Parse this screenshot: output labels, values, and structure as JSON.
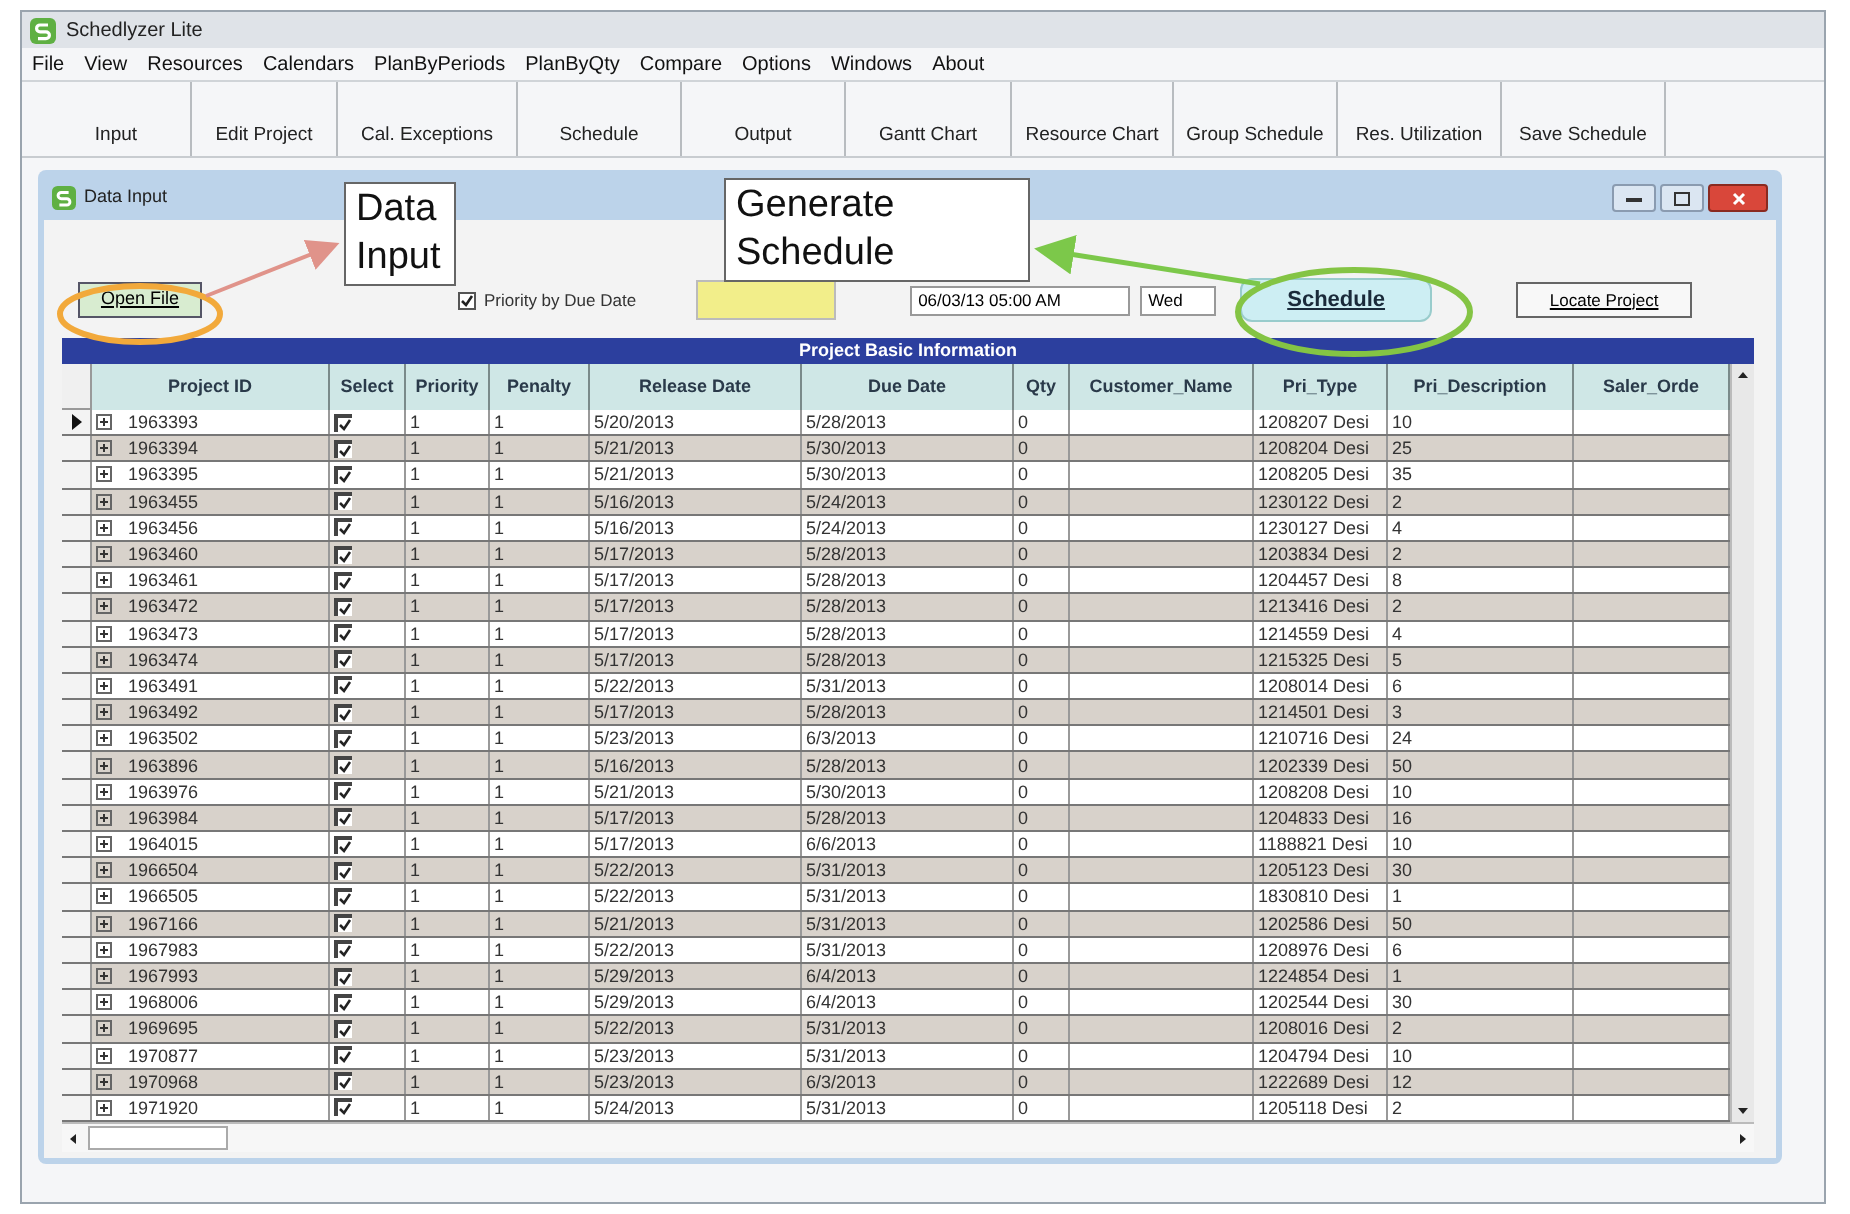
{
  "window": {
    "title": "Schedlyzer Lite"
  },
  "menu": [
    "File",
    "View",
    "Resources",
    "Calendars",
    "PlanByPeriods",
    "PlanByQty",
    "Compare",
    "Options",
    "Windows",
    "About"
  ],
  "toolbar": [
    "Input",
    "Edit Project",
    "Cal. Exceptions",
    "Schedule",
    "Output",
    "Gantt Chart",
    "Resource Chart",
    "Group Schedule",
    "Res. Utilization",
    "Save Schedule"
  ],
  "child_window": {
    "title": "Data Input",
    "controls": {
      "open_file": "Open File",
      "priority_checkbox": {
        "label": "Priority by Due Date",
        "checked": true
      },
      "date_field": "06/03/13 05:00 AM",
      "day_field": "Wed",
      "schedule": "Schedule",
      "locate_project": "Locate Project"
    }
  },
  "annotations": [
    {
      "text": "Data Input"
    },
    {
      "text": "Generate Schedule"
    }
  ],
  "table": {
    "caption": "Project Basic Information",
    "columns": [
      "Project ID",
      "Select",
      "Priority",
      "Penalty",
      "Release Date",
      "Due Date",
      "Qty",
      "Customer_Name",
      "Pri_Type",
      "Pri_Description",
      "Saler_Orde"
    ],
    "rows": [
      {
        "current": true,
        "project_id": "1963393",
        "select": true,
        "priority": "1",
        "penalty": "1",
        "release_date": "5/20/2013",
        "due_date": "5/28/2013",
        "qty": "0",
        "pri_type": "1208207 Desi",
        "pri_description": "10"
      },
      {
        "current": false,
        "project_id": "1963394",
        "select": true,
        "priority": "1",
        "penalty": "1",
        "release_date": "5/21/2013",
        "due_date": "5/30/2013",
        "qty": "0",
        "pri_type": "1208204 Desi",
        "pri_description": "25"
      },
      {
        "current": false,
        "project_id": "1963395",
        "select": true,
        "priority": "1",
        "penalty": "1",
        "release_date": "5/21/2013",
        "due_date": "5/30/2013",
        "qty": "0",
        "pri_type": "1208205 Desi",
        "pri_description": "35"
      },
      {
        "current": false,
        "project_id": "1963455",
        "select": true,
        "priority": "1",
        "penalty": "1",
        "release_date": "5/16/2013",
        "due_date": "5/24/2013",
        "qty": "0",
        "pri_type": "1230122 Desi",
        "pri_description": "2"
      },
      {
        "current": false,
        "project_id": "1963456",
        "select": true,
        "priority": "1",
        "penalty": "1",
        "release_date": "5/16/2013",
        "due_date": "5/24/2013",
        "qty": "0",
        "pri_type": "1230127 Desi",
        "pri_description": "4"
      },
      {
        "current": false,
        "project_id": "1963460",
        "select": true,
        "priority": "1",
        "penalty": "1",
        "release_date": "5/17/2013",
        "due_date": "5/28/2013",
        "qty": "0",
        "pri_type": "1203834 Desi",
        "pri_description": "2"
      },
      {
        "current": false,
        "project_id": "1963461",
        "select": true,
        "priority": "1",
        "penalty": "1",
        "release_date": "5/17/2013",
        "due_date": "5/28/2013",
        "qty": "0",
        "pri_type": "1204457 Desi",
        "pri_description": "8"
      },
      {
        "current": false,
        "project_id": "1963472",
        "select": true,
        "priority": "1",
        "penalty": "1",
        "release_date": "5/17/2013",
        "due_date": "5/28/2013",
        "qty": "0",
        "pri_type": "1213416 Desi",
        "pri_description": "2"
      },
      {
        "current": false,
        "project_id": "1963473",
        "select": true,
        "priority": "1",
        "penalty": "1",
        "release_date": "5/17/2013",
        "due_date": "5/28/2013",
        "qty": "0",
        "pri_type": "1214559 Desi",
        "pri_description": "4"
      },
      {
        "current": false,
        "project_id": "1963474",
        "select": true,
        "priority": "1",
        "penalty": "1",
        "release_date": "5/17/2013",
        "due_date": "5/28/2013",
        "qty": "0",
        "pri_type": "1215325 Desi",
        "pri_description": "5"
      },
      {
        "current": false,
        "project_id": "1963491",
        "select": true,
        "priority": "1",
        "penalty": "1",
        "release_date": "5/22/2013",
        "due_date": "5/31/2013",
        "qty": "0",
        "pri_type": "1208014 Desi",
        "pri_description": "6"
      },
      {
        "current": false,
        "project_id": "1963492",
        "select": true,
        "priority": "1",
        "penalty": "1",
        "release_date": "5/17/2013",
        "due_date": "5/28/2013",
        "qty": "0",
        "pri_type": "1214501 Desi",
        "pri_description": "3"
      },
      {
        "current": false,
        "project_id": "1963502",
        "select": true,
        "priority": "1",
        "penalty": "1",
        "release_date": "5/23/2013",
        "due_date": "6/3/2013",
        "qty": "0",
        "pri_type": "1210716 Desi",
        "pri_description": "24"
      },
      {
        "current": false,
        "project_id": "1963896",
        "select": true,
        "priority": "1",
        "penalty": "1",
        "release_date": "5/16/2013",
        "due_date": "5/28/2013",
        "qty": "0",
        "pri_type": "1202339 Desi",
        "pri_description": "50"
      },
      {
        "current": false,
        "project_id": "1963976",
        "select": true,
        "priority": "1",
        "penalty": "1",
        "release_date": "5/21/2013",
        "due_date": "5/30/2013",
        "qty": "0",
        "pri_type": "1208208 Desi",
        "pri_description": "10"
      },
      {
        "current": false,
        "project_id": "1963984",
        "select": true,
        "priority": "1",
        "penalty": "1",
        "release_date": "5/17/2013",
        "due_date": "5/28/2013",
        "qty": "0",
        "pri_type": "1204833 Desi",
        "pri_description": "16"
      },
      {
        "current": false,
        "project_id": "1964015",
        "select": true,
        "priority": "1",
        "penalty": "1",
        "release_date": "5/17/2013",
        "due_date": "6/6/2013",
        "qty": "0",
        "pri_type": "1188821 Desi",
        "pri_description": "10"
      },
      {
        "current": false,
        "project_id": "1966504",
        "select": true,
        "priority": "1",
        "penalty": "1",
        "release_date": "5/22/2013",
        "due_date": "5/31/2013",
        "qty": "0",
        "pri_type": "1205123 Desi",
        "pri_description": "30"
      },
      {
        "current": false,
        "project_id": "1966505",
        "select": true,
        "priority": "1",
        "penalty": "1",
        "release_date": "5/22/2013",
        "due_date": "5/31/2013",
        "qty": "0",
        "pri_type": "1830810 Desi",
        "pri_description": "1"
      },
      {
        "current": false,
        "project_id": "1967166",
        "select": true,
        "priority": "1",
        "penalty": "1",
        "release_date": "5/21/2013",
        "due_date": "5/31/2013",
        "qty": "0",
        "pri_type": "1202586 Desi",
        "pri_description": "50"
      },
      {
        "current": false,
        "project_id": "1967983",
        "select": true,
        "priority": "1",
        "penalty": "1",
        "release_date": "5/22/2013",
        "due_date": "5/31/2013",
        "qty": "0",
        "pri_type": "1208976 Desi",
        "pri_description": "6"
      },
      {
        "current": false,
        "project_id": "1967993",
        "select": true,
        "priority": "1",
        "penalty": "1",
        "release_date": "5/29/2013",
        "due_date": "6/4/2013",
        "qty": "0",
        "pri_type": "1224854 Desi",
        "pri_description": "1"
      },
      {
        "current": false,
        "project_id": "1968006",
        "select": true,
        "priority": "1",
        "penalty": "1",
        "release_date": "5/29/2013",
        "due_date": "6/4/2013",
        "qty": "0",
        "pri_type": "1202544 Desi",
        "pri_description": "30"
      },
      {
        "current": false,
        "project_id": "1969695",
        "select": true,
        "priority": "1",
        "penalty": "1",
        "release_date": "5/22/2013",
        "due_date": "5/31/2013",
        "qty": "0",
        "pri_type": "1208016 Desi",
        "pri_description": "2"
      },
      {
        "current": false,
        "project_id": "1970877",
        "select": true,
        "priority": "1",
        "penalty": "1",
        "release_date": "5/23/2013",
        "due_date": "5/31/2013",
        "qty": "0",
        "pri_type": "1204794 Desi",
        "pri_description": "10"
      },
      {
        "current": false,
        "project_id": "1970968",
        "select": true,
        "priority": "1",
        "penalty": "1",
        "release_date": "5/23/2013",
        "due_date": "6/3/2013",
        "qty": "0",
        "pri_type": "1222689 Desi",
        "pri_description": "12"
      },
      {
        "current": false,
        "project_id": "1971920",
        "select": true,
        "priority": "1",
        "penalty": "1",
        "release_date": "5/24/2013",
        "due_date": "5/31/2013",
        "qty": "0",
        "pri_type": "1205118 Desi",
        "pri_description": "2"
      }
    ]
  }
}
